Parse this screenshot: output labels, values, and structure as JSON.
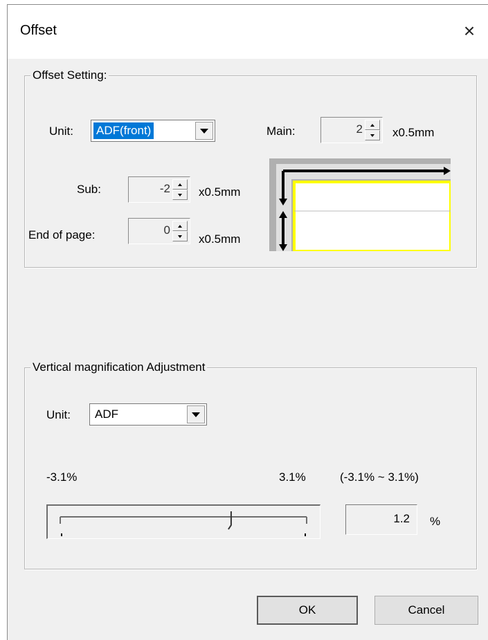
{
  "window": {
    "title": "Offset",
    "close_icon": "×"
  },
  "offset_setting": {
    "group_label": "Offset Setting:",
    "unit_label": "Unit:",
    "unit_value": "ADF(front)",
    "main_label": "Main:",
    "main_value": "2",
    "main_unit": "x0.5mm",
    "sub_label": "Sub:",
    "sub_value": "-2",
    "sub_unit": "x0.5mm",
    "end_label": "End of page:",
    "end_value": "0",
    "end_unit": "x0.5mm",
    "preview_colors": {
      "paper": "#ffffff",
      "edge": "#ffff00",
      "background": "#b0b0b0",
      "arrow": "#000000"
    }
  },
  "vertical_adjustment": {
    "group_label": "Vertical magnification Adjustment",
    "unit_label": "Unit:",
    "unit_value": "ADF",
    "min_label": "-3.1%",
    "max_label": "3.1%",
    "range_label": "(-3.1% ~ 3.1%)",
    "slider_min": -3.1,
    "slider_max": 3.1,
    "slider_value": 1.2,
    "value_text": "1.2",
    "percent_sign": "%"
  },
  "buttons": {
    "ok": "OK",
    "cancel": "Cancel"
  },
  "colors": {
    "accent": "#0078d7",
    "dialog_bg": "#f0f0f0"
  }
}
